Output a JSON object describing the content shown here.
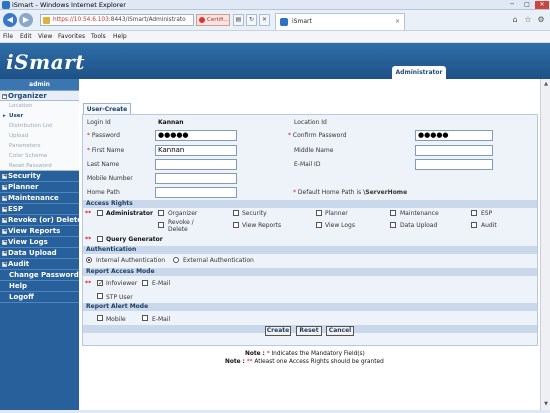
{
  "window": {
    "title": "iSmart - Windows Internet Explorer"
  },
  "browser": {
    "address_host": "https://10.54.6.103",
    "address_path": ":8443/iSmart/Administrato",
    "cert_label": "Certifi...",
    "tab_title": "iSmart",
    "menu": [
      "File",
      "Edit",
      "View",
      "Favorites",
      "Tools",
      "Help"
    ]
  },
  "app": {
    "logo": "iSmart",
    "role_tab": "Administrator"
  },
  "sidebar": {
    "user": "admin",
    "organizer": "Organizer",
    "organizer_items": [
      "Location",
      "User",
      "Distribution List",
      "Upload",
      "Parameters",
      "Color Scheme",
      "Reset Password"
    ],
    "top": [
      "Security",
      "Planner",
      "Maintenance",
      "ESP",
      "Revoke (or) Delete",
      "View Reports",
      "View Logs",
      "Data Upload",
      "Audit"
    ],
    "links": [
      "Change Password",
      "Help",
      "Logoff"
    ]
  },
  "form": {
    "tab": "User-Create",
    "login_id_label": "Login Id",
    "login_id_value": "Kannan",
    "location_id_label": "Location Id",
    "password_label": "Password",
    "password_value": "●●●●●",
    "confirm_label": "Confirm Password",
    "confirm_value": "●●●●●",
    "first_name_label": "First Name",
    "first_name_value": "Kannan",
    "middle_name_label": "Middle Name",
    "last_name_label": "Last Name",
    "email_label": "E-Mail ID",
    "mobile_label": "Mobile Number",
    "home_path_label": "Home Path",
    "default_home_note": "Default Home Path is",
    "default_home_value": "\\ServerHome",
    "req_single": "*",
    "req_double": "**",
    "access_rights_header": "Access Rights",
    "rights": [
      "Administrator",
      "Organizer",
      "Security",
      "Planner",
      "Maintenance",
      "ESP",
      "Revoke / Delete",
      "View Reports",
      "View Logs",
      "Data Upload",
      "Audit",
      "Query Generator"
    ],
    "auth_header": "Authentication",
    "auth_internal": "Internal Authentication",
    "auth_external": "External Authentication",
    "report_access_header": "Report Access Mode",
    "infoviewer": "Infoviewer",
    "email": "E-Mail",
    "stp_user": "STP User",
    "report_alert_header": "Report Alert Mode",
    "mobile": "Mobile",
    "alert_email": "E-Mail",
    "buttons": {
      "create": "Create",
      "reset": "Reset",
      "cancel": "Cancel"
    },
    "note_label": "Note :",
    "note1": "Indicates the Mandatory Field(s)",
    "note2": "Atleast one Access Rights should be granted"
  }
}
